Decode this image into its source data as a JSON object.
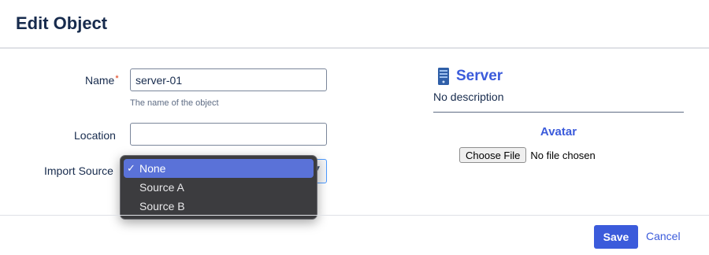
{
  "dialog": {
    "title": "Edit Object"
  },
  "form": {
    "name": {
      "label": "Name",
      "required_mark": "*",
      "value": "server-01",
      "hint": "The name of the object"
    },
    "location": {
      "label": "Location",
      "value": ""
    },
    "import_source": {
      "label": "Import Source",
      "selected": "None",
      "options": [
        {
          "label": "None",
          "selected": true,
          "check": "✓"
        },
        {
          "label": "Source A",
          "selected": false
        },
        {
          "label": "Source B",
          "selected": false
        }
      ]
    }
  },
  "object_type": {
    "name": "Server",
    "description": "No description",
    "icon": "server-icon"
  },
  "avatar": {
    "title": "Avatar",
    "choose_label": "Choose File",
    "status": "No file chosen"
  },
  "footer": {
    "save_label": "Save",
    "cancel_label": "Cancel"
  },
  "colors": {
    "accent": "#3b5bdb",
    "required": "#de350b",
    "dropdown_bg": "#3c3c3f",
    "dropdown_selected": "#5a72d8"
  }
}
